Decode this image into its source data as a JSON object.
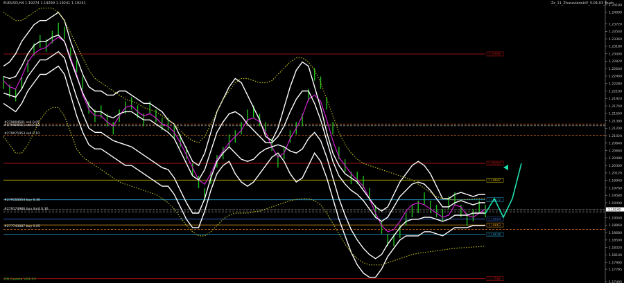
{
  "header": {
    "symbol_line": "EURUSD,H4  1.19274 1.19299 1.19241 1.19241",
    "indicator_name": "Zz_11_ZhuravlenskiV_V-04-03_Bush"
  },
  "footer": {
    "signature": "ZiB Gazeta V04.03"
  },
  "chart_data": {
    "type": "line",
    "title": "EURUSD,H4",
    "price_axis": {
      "min": 1.17495,
      "max": 1.2418,
      "ticks": [
        "1.24180",
        "1.24000",
        "1.23720",
        "1.23540",
        "1.23360",
        "1.23180",
        "1.23000",
        "1.22820",
        "1.22640",
        "1.22460",
        "1.22280",
        "1.22100",
        "1.21920",
        "1.21740",
        "1.21560",
        "1.21380",
        "1.21200",
        "1.21020",
        "1.20840",
        "1.20660",
        "1.20480",
        "1.20300",
        "1.20120",
        "1.19940",
        "1.19760",
        "1.19580",
        "1.19400",
        "1.19220",
        "1.19040",
        "1.18860",
        "1.18680",
        "1.18500",
        "1.18320",
        "1.18140",
        "1.17960",
        "1.17795",
        "1.17495"
      ],
      "current_price": "1.19240"
    },
    "horizontal_levels": [
      {
        "price": 1.22994,
        "label": "1.22994",
        "color": "#c81414",
        "style": "solid"
      },
      {
        "price": 1.213,
        "label": "",
        "color": "#d2691e",
        "style": "dashed"
      },
      {
        "price": 1.2126,
        "label": "",
        "color": "#a0a0a0",
        "style": "dashed"
      },
      {
        "price": 1.2103,
        "label": "",
        "color": "#d2691e",
        "style": "dashed"
      },
      {
        "price": 1.20353,
        "label": "1.20353",
        "color": "#e01818",
        "style": "solid"
      },
      {
        "price": 1.19947,
        "label": "1.19947",
        "color": "#e6d200",
        "style": "solid"
      },
      {
        "price": 1.19472,
        "label": "1.19472",
        "color": "#2aa0d0",
        "style": "solid"
      },
      {
        "price": 1.1923,
        "label": "",
        "color": "#808080",
        "style": "dashed"
      },
      {
        "price": 1.1918,
        "label": "",
        "color": "#808080",
        "style": "dashed"
      },
      {
        "price": 1.19004,
        "label": "1.19004",
        "color": "#3a6fd8",
        "style": "solid"
      },
      {
        "price": 1.18863,
        "label": "1.18863",
        "color": "#e8a020",
        "style": "solid"
      },
      {
        "price": 1.18758,
        "label": "",
        "color": "#d2691e",
        "style": "dashed"
      },
      {
        "price": 1.18638,
        "label": "1.18638",
        "color": "#2aa0d0",
        "style": "solid"
      },
      {
        "price": 1.17566,
        "label": "1.17566",
        "color": "#c81414",
        "style": "solid"
      }
    ],
    "order_labels": [
      {
        "text": "#279004501 sell 0.05",
        "price": 1.2131
      },
      {
        "text": "#279006511 sell 0.10",
        "price": 1.2124
      },
      {
        "text": "#279071453 sell 0.10",
        "price": 1.2104
      },
      {
        "text": "#279155054 buy 0.30",
        "price": 1.1944
      },
      {
        "text": "#279174986 buy limit 0.30",
        "price": 1.1922
      },
      {
        "text": "#277743087 buy 0.05",
        "price": 1.188
      }
    ],
    "series": [
      {
        "name": "price",
        "color": "#1fc21f",
        "values": [
          1.223,
          1.221,
          1.22,
          1.223,
          1.227,
          1.231,
          1.233,
          1.232,
          1.234,
          1.236,
          1.235,
          1.23,
          1.227,
          1.223,
          1.217,
          1.215,
          1.216,
          1.214,
          1.212,
          1.215,
          1.217,
          1.218,
          1.216,
          1.214,
          1.217,
          1.215,
          1.213,
          1.213,
          1.211,
          1.209,
          1.206,
          1.202,
          1.199,
          1.196,
          1.2,
          1.204,
          1.206,
          1.209,
          1.21,
          1.212,
          1.215,
          1.216,
          1.214,
          1.212,
          1.208,
          1.204,
          1.206,
          1.21,
          1.212,
          1.214,
          1.22,
          1.225,
          1.223,
          1.218,
          1.212,
          1.206,
          1.203,
          1.2,
          1.2,
          1.199,
          1.196,
          1.192,
          1.188,
          1.185,
          1.185,
          1.187,
          1.19,
          1.192,
          1.193,
          1.195,
          1.193,
          1.192,
          1.191,
          1.194,
          1.195,
          1.192,
          1.19,
          1.191,
          1.193,
          1.192
        ]
      },
      {
        "name": "fast average",
        "color": "#d020d0",
        "values": [
          1.2235,
          1.222,
          1.2215,
          1.2245,
          1.228,
          1.23,
          1.231,
          1.2315,
          1.233,
          1.234,
          1.233,
          1.229,
          1.225,
          1.22,
          1.2165,
          1.215,
          1.215,
          1.2135,
          1.2125,
          1.215,
          1.217,
          1.2175,
          1.216,
          1.215,
          1.2155,
          1.2145,
          1.213,
          1.2125,
          1.211,
          1.2085,
          1.2055,
          1.2025,
          1.1995,
          1.1985,
          1.201,
          1.2045,
          1.2065,
          1.2085,
          1.21,
          1.2115,
          1.214,
          1.2145,
          1.2135,
          1.211,
          1.2075,
          1.205,
          1.206,
          1.2095,
          1.212,
          1.215,
          1.219,
          1.22,
          1.2185,
          1.214,
          1.209,
          1.205,
          1.203,
          1.201,
          1.1995,
          1.198,
          1.195,
          1.1915,
          1.1885,
          1.187,
          1.1875,
          1.1895,
          1.192,
          1.1935,
          1.194,
          1.1935,
          1.1925,
          1.1915,
          1.1905,
          1.191,
          1.1935,
          1.193,
          1.191,
          1.1905,
          1.1915,
          1.1925
        ]
      },
      {
        "name": "upper band",
        "color": "#ffffff",
        "values": [
          1.227,
          1.228,
          1.23,
          1.233,
          1.235,
          1.237,
          1.238,
          1.238,
          1.239,
          1.24,
          1.238,
          1.233,
          1.229,
          1.225,
          1.222,
          1.221,
          1.221,
          1.22,
          1.22,
          1.221,
          1.221,
          1.22,
          1.219,
          1.218,
          1.218,
          1.217,
          1.216,
          1.214,
          1.213,
          1.21,
          1.207,
          1.204,
          1.203,
          1.206,
          1.211,
          1.216,
          1.219,
          1.222,
          1.224,
          1.223,
          1.22,
          1.217,
          1.214,
          1.21,
          1.209,
          1.212,
          1.217,
          1.222,
          1.226,
          1.228,
          1.227,
          1.222,
          1.217,
          1.211,
          1.206,
          1.203,
          1.201,
          1.2,
          1.199,
          1.197,
          1.195,
          1.193,
          1.192,
          1.193,
          1.196,
          1.199,
          1.201,
          1.203,
          1.204,
          1.203,
          1.201,
          1.198,
          1.195,
          1.195,
          1.196,
          1.1965,
          1.196,
          1.1955,
          1.196,
          1.196
        ]
      },
      {
        "name": "lower band",
        "color": "#ffffff",
        "values": [
          1.218,
          1.217,
          1.216,
          1.218,
          1.221,
          1.223,
          1.225,
          1.225,
          1.226,
          1.227,
          1.225,
          1.22,
          1.215,
          1.211,
          1.208,
          1.207,
          1.207,
          1.206,
          1.205,
          1.204,
          1.203,
          1.203,
          1.202,
          1.201,
          1.2,
          1.199,
          1.198,
          1.198,
          1.196,
          1.193,
          1.19,
          1.188,
          1.188,
          1.192,
          1.197,
          1.201,
          1.203,
          1.204,
          1.201,
          1.199,
          1.198,
          1.199,
          1.201,
          1.203,
          1.205,
          1.206,
          1.204,
          1.201,
          1.199,
          1.2,
          1.203,
          1.206,
          1.204,
          1.2,
          1.195,
          1.19,
          1.186,
          1.182,
          1.179,
          1.177,
          1.176,
          1.176,
          1.178,
          1.181,
          1.183,
          1.185,
          1.186,
          1.186,
          1.186,
          1.187,
          1.187,
          1.1865,
          1.186,
          1.187,
          1.188,
          1.188,
          1.188,
          1.1885,
          1.1885,
          1.1885
        ]
      },
      {
        "name": "inner upper",
        "color": "#ffffff",
        "values": [
          1.2245,
          1.224,
          1.2245,
          1.227,
          1.23,
          1.232,
          1.233,
          1.233,
          1.234,
          1.2345,
          1.233,
          1.2285,
          1.2245,
          1.2205,
          1.2175,
          1.216,
          1.216,
          1.215,
          1.2145,
          1.2155,
          1.216,
          1.216,
          1.215,
          1.214,
          1.214,
          1.213,
          1.212,
          1.211,
          1.2095,
          1.2065,
          1.2035,
          1.2005,
          1.1995,
          1.202,
          1.2065,
          1.211,
          1.2135,
          1.2155,
          1.216,
          1.215,
          1.213,
          1.2115,
          1.21,
          1.2085,
          1.2085,
          1.21,
          1.2125,
          1.216,
          1.219,
          1.221,
          1.221,
          1.218,
          1.214,
          1.209,
          1.204,
          1.2005,
          1.1985,
          1.197,
          1.196,
          1.1945,
          1.1925,
          1.1905,
          1.1895,
          1.1905,
          1.193,
          1.1955,
          1.197,
          1.1985,
          1.199,
          1.1985,
          1.197,
          1.195,
          1.193,
          1.193,
          1.194,
          1.1945,
          1.194,
          1.1935,
          1.194,
          1.194
        ]
      },
      {
        "name": "inner lower",
        "color": "#ffffff",
        "values": [
          1.2205,
          1.22,
          1.2195,
          1.2215,
          1.2245,
          1.2265,
          1.2285,
          1.2285,
          1.2295,
          1.2305,
          1.229,
          1.224,
          1.2195,
          1.2155,
          1.212,
          1.211,
          1.211,
          1.21,
          1.209,
          1.2085,
          1.208,
          1.2075,
          1.2065,
          1.2055,
          1.2045,
          1.2035,
          1.2025,
          1.202,
          1.2,
          1.197,
          1.194,
          1.1915,
          1.1915,
          1.195,
          1.2,
          1.204,
          1.206,
          1.2075,
          1.206,
          1.2045,
          1.204,
          1.2045,
          1.206,
          1.207,
          1.2075,
          1.208,
          1.2075,
          1.2065,
          1.206,
          1.207,
          1.2095,
          1.211,
          1.209,
          1.205,
          1.2,
          1.195,
          1.191,
          1.1875,
          1.185,
          1.183,
          1.1815,
          1.1805,
          1.1815,
          1.184,
          1.186,
          1.188,
          1.1895,
          1.19,
          1.19,
          1.1905,
          1.1905,
          1.19,
          1.1895,
          1.19,
          1.191,
          1.191,
          1.191,
          1.1915,
          1.1915,
          1.1915
        ]
      },
      {
        "name": "outer upper",
        "color": "#b8b820",
        "values": [
          1.24,
          1.239,
          1.238,
          1.238,
          1.239,
          1.24,
          1.241,
          1.241,
          1.241,
          1.24,
          1.238,
          1.235,
          1.232,
          1.229,
          1.226,
          1.224,
          1.223,
          1.222,
          1.221,
          1.22,
          1.219,
          1.2185,
          1.218,
          1.217,
          1.2165,
          1.216,
          1.215,
          1.214,
          1.213,
          1.2115,
          1.21,
          1.209,
          1.2085,
          1.21,
          1.213,
          1.216,
          1.219,
          1.221,
          1.223,
          1.224,
          1.224,
          1.2235,
          1.223,
          1.223,
          1.2235,
          1.225,
          1.2265,
          1.228,
          1.229,
          1.229,
          1.228,
          1.226,
          1.223,
          1.219,
          1.215,
          1.211,
          1.208,
          1.206,
          1.2045,
          1.2035,
          1.203,
          1.2025,
          1.202,
          1.2015,
          1.201,
          1.2005,
          1.2,
          1.1995,
          1.1985,
          1.1975,
          1.1965,
          1.1955,
          1.195,
          1.1948,
          1.1947,
          1.1947,
          1.1948,
          1.1949,
          1.195,
          1.195
        ]
      },
      {
        "name": "outer lower",
        "color": "#b8b820",
        "values": [
          1.21,
          1.208,
          1.206,
          1.206,
          1.208,
          1.211,
          1.214,
          1.216,
          1.217,
          1.217,
          1.215,
          1.211,
          1.207,
          1.205,
          1.204,
          1.203,
          1.202,
          1.201,
          1.2,
          1.199,
          1.1985,
          1.198,
          1.1975,
          1.197,
          1.1965,
          1.196,
          1.195,
          1.194,
          1.1925,
          1.1905,
          1.1885,
          1.187,
          1.186,
          1.186,
          1.187,
          1.1885,
          1.19,
          1.191,
          1.1915,
          1.1915,
          1.1915,
          1.1918,
          1.192,
          1.1925,
          1.193,
          1.1935,
          1.194,
          1.1945,
          1.1948,
          1.195,
          1.195,
          1.1945,
          1.1935,
          1.1915,
          1.189,
          1.1865,
          1.184,
          1.182,
          1.1805,
          1.1795,
          1.179,
          1.179,
          1.179,
          1.1795,
          1.18,
          1.1805,
          1.181,
          1.1815,
          1.1818,
          1.182,
          1.1822,
          1.1824,
          1.1826,
          1.1828,
          1.183,
          1.1831,
          1.1832,
          1.1833,
          1.1834,
          1.1835
        ]
      },
      {
        "name": "projection",
        "color": "#20e0b0",
        "values": [
          1.1914,
          1.195,
          1.1905,
          1.195,
          1.2035
        ]
      }
    ]
  }
}
